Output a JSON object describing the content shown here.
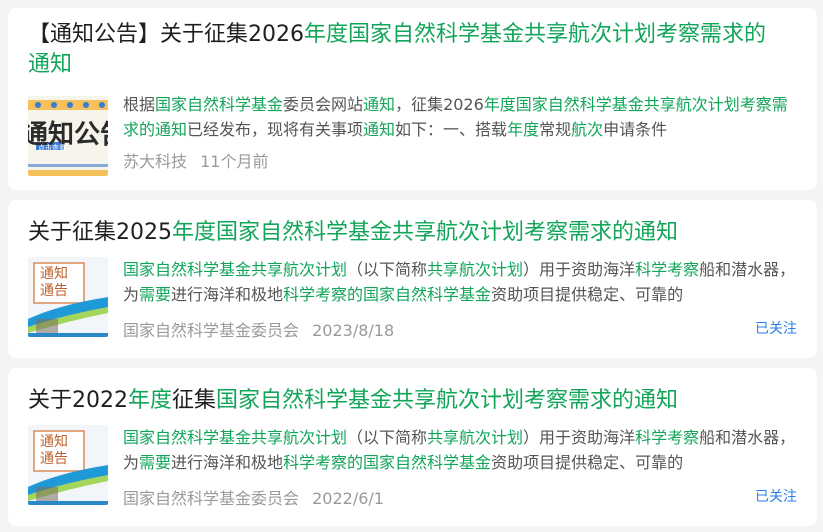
{
  "results": [
    {
      "title_parts": [
        {
          "t": "【通知公告】关于征集2026",
          "h": false
        },
        {
          "t": "年度国家自然科学基金共享航次计划考察需求的通知",
          "h": true
        }
      ],
      "snippet_parts": [
        {
          "t": "根据",
          "h": false
        },
        {
          "t": "国家自然科学基金",
          "h": true
        },
        {
          "t": "委员会网站",
          "h": false
        },
        {
          "t": "通知",
          "h": true
        },
        {
          "t": "，征集2026",
          "h": false
        },
        {
          "t": "年度国家自然科学基金共享航次计划考察需求的通知",
          "h": true
        },
        {
          "t": "已经发布，现将有关事项",
          "h": false
        },
        {
          "t": "通知",
          "h": true
        },
        {
          "t": "如下：一、搭载",
          "h": false
        },
        {
          "t": "年度",
          "h": true
        },
        {
          "t": "常规",
          "h": false
        },
        {
          "t": "航次",
          "h": true
        },
        {
          "t": "申请条件",
          "h": false
        }
      ],
      "thumb_text": "通知公告",
      "thumb_badge": "点击查看",
      "source": "苏大科技",
      "time": "11个月前",
      "follow": ""
    },
    {
      "title_parts": [
        {
          "t": "关于征集2025",
          "h": false
        },
        {
          "t": "年度国家自然科学基金共享航次计划考察需求的通知",
          "h": true
        }
      ],
      "snippet_parts": [
        {
          "t": "国家自然科学基金共享航次计划",
          "h": true
        },
        {
          "t": "（以下简称",
          "h": false
        },
        {
          "t": "共享航次计划",
          "h": true
        },
        {
          "t": "）用于资助海洋",
          "h": false
        },
        {
          "t": "科学考察",
          "h": true
        },
        {
          "t": "船和潜水器，为",
          "h": false
        },
        {
          "t": "需要",
          "h": true
        },
        {
          "t": "进行海洋和极地",
          "h": false
        },
        {
          "t": "科学考察的国家自然科学基金",
          "h": true
        },
        {
          "t": "资助项目提供稳定、可靠的",
          "h": false
        }
      ],
      "thumb_text": "通知通告",
      "source": "国家自然科学基金委员会",
      "time": "2023/8/18",
      "follow": "已关注"
    },
    {
      "title_parts": [
        {
          "t": "关于2022",
          "h": false
        },
        {
          "t": "年度",
          "h": true
        },
        {
          "t": "征集",
          "h": false
        },
        {
          "t": "国家自然科学基金共享航次计划考察需求的通知",
          "h": true
        }
      ],
      "snippet_parts": [
        {
          "t": "国家自然科学基金共享航次计划",
          "h": true
        },
        {
          "t": "（以下简称",
          "h": false
        },
        {
          "t": "共享航次计划",
          "h": true
        },
        {
          "t": "）用于资助海洋",
          "h": false
        },
        {
          "t": "科学考察",
          "h": true
        },
        {
          "t": "船和潜水器，为",
          "h": false
        },
        {
          "t": "需要",
          "h": true
        },
        {
          "t": "进行海洋和极地",
          "h": false
        },
        {
          "t": "科学考察的国家自然科学基金",
          "h": true
        },
        {
          "t": "资助项目提供稳定、可靠的",
          "h": false
        }
      ],
      "thumb_text": "通知通告",
      "source": "国家自然科学基金委员会",
      "time": "2022/6/1",
      "follow": "已关注"
    }
  ]
}
